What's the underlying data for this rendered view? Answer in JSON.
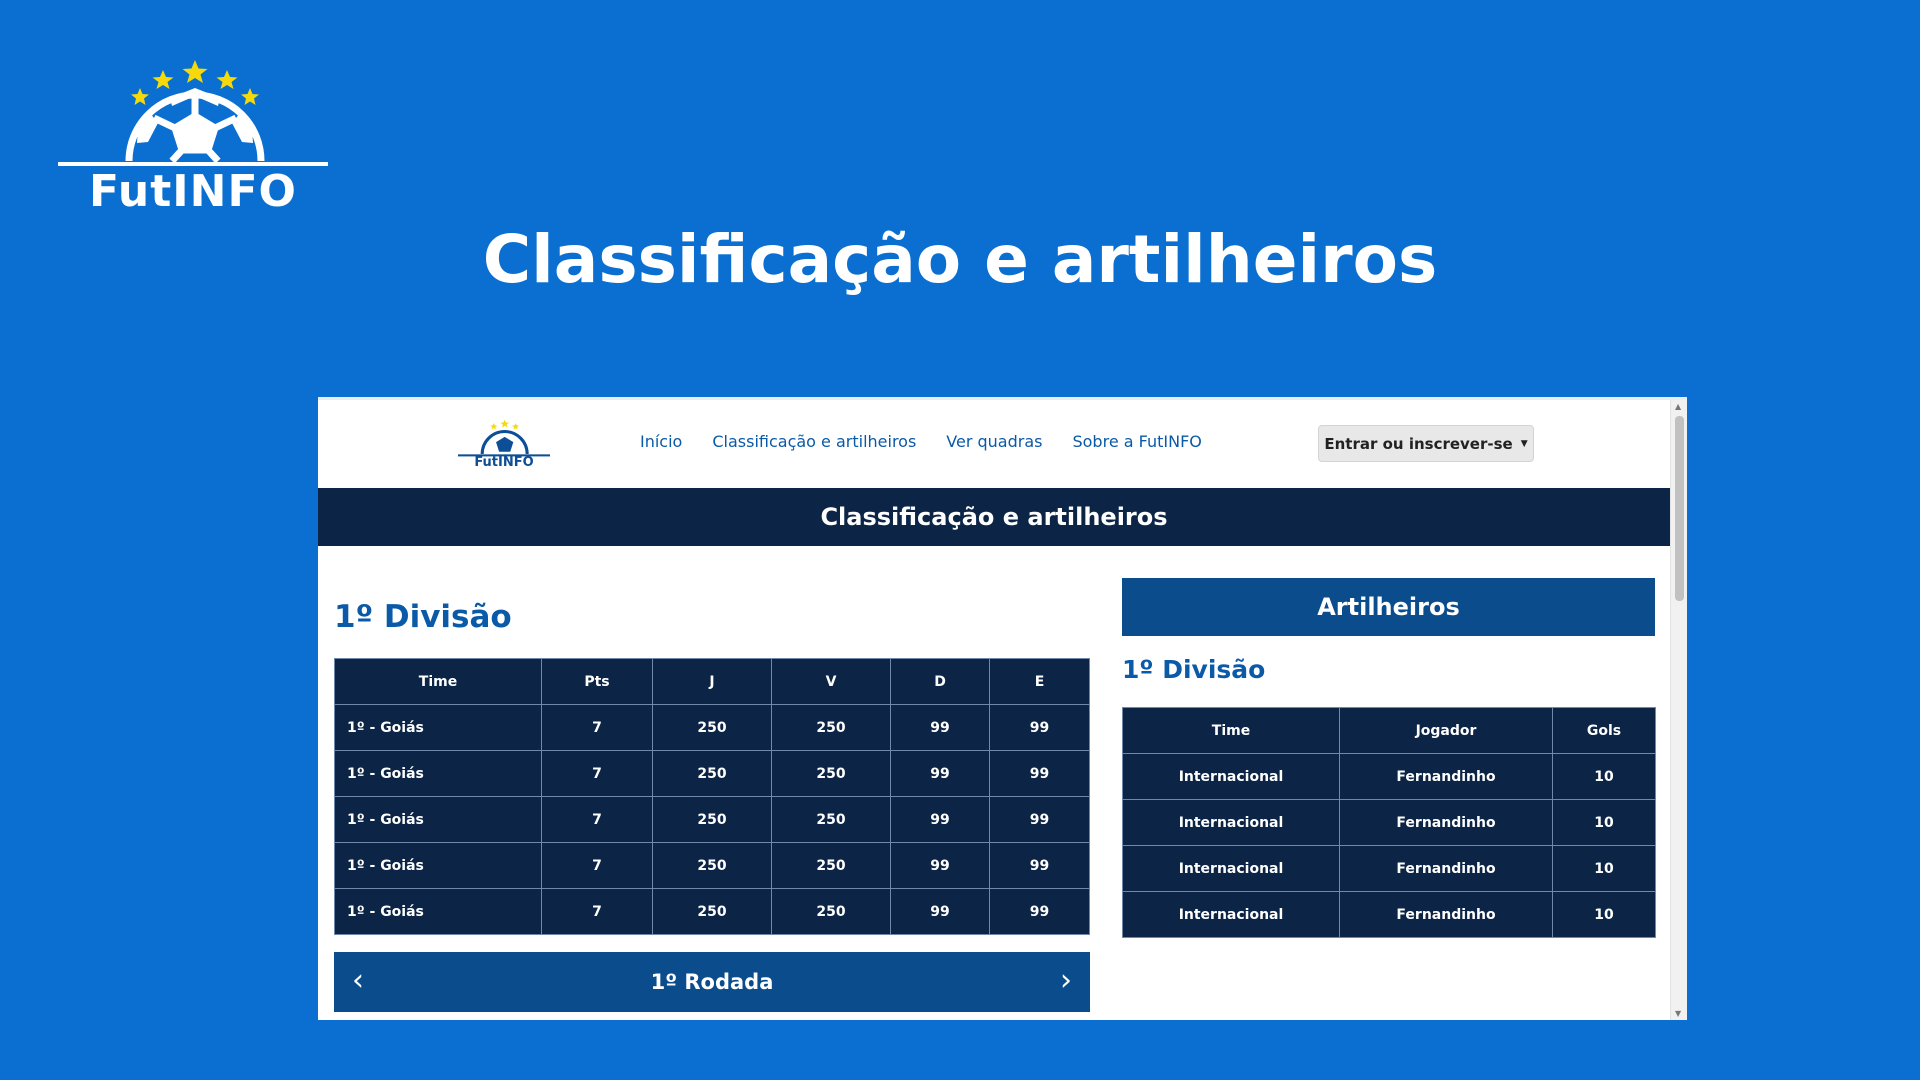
{
  "brand": {
    "name": "FutINFO"
  },
  "slide": {
    "title": "Classificação e artilheiros"
  },
  "colors": {
    "background": "#0a6fd0",
    "dark_navy": "#0c2546",
    "blue": "#0a4c8c",
    "star": "#f5d90a"
  },
  "navbar": {
    "logo_text": "FutINFO",
    "links": [
      "Início",
      "Classificação e artilheiros",
      "Ver quadras",
      "Sobre a FutINFO"
    ],
    "login_label": "Entrar ou inscrever-se"
  },
  "page": {
    "title": "Classificação e artilheiros"
  },
  "standings": {
    "division_title": "1º Divisão",
    "headers": [
      "Time",
      "Pts",
      "J",
      "V",
      "D",
      "E"
    ],
    "rows": [
      [
        "1º - Goiás",
        "7",
        "250",
        "250",
        "99",
        "99"
      ],
      [
        "1º - Goiás",
        "7",
        "250",
        "250",
        "99",
        "99"
      ],
      [
        "1º - Goiás",
        "7",
        "250",
        "250",
        "99",
        "99"
      ],
      [
        "1º - Goiás",
        "7",
        "250",
        "250",
        "99",
        "99"
      ],
      [
        "1º - Goiás",
        "7",
        "250",
        "250",
        "99",
        "99"
      ]
    ],
    "round_label": "1º Rodada"
  },
  "scorers": {
    "header": "Artilheiros",
    "division_title": "1º Divisão",
    "headers": [
      "Time",
      "Jogador",
      "Gols"
    ],
    "rows": [
      [
        "Internacional",
        "Fernandinho",
        "10"
      ],
      [
        "Internacional",
        "Fernandinho",
        "10"
      ],
      [
        "Internacional",
        "Fernandinho",
        "10"
      ],
      [
        "Internacional",
        "Fernandinho",
        "10"
      ]
    ]
  },
  "icons": {
    "prev": "chevron-left-icon",
    "next": "chevron-right-icon",
    "dropdown": "caret-down-icon",
    "logo": "soccer-ball-stars-icon"
  }
}
